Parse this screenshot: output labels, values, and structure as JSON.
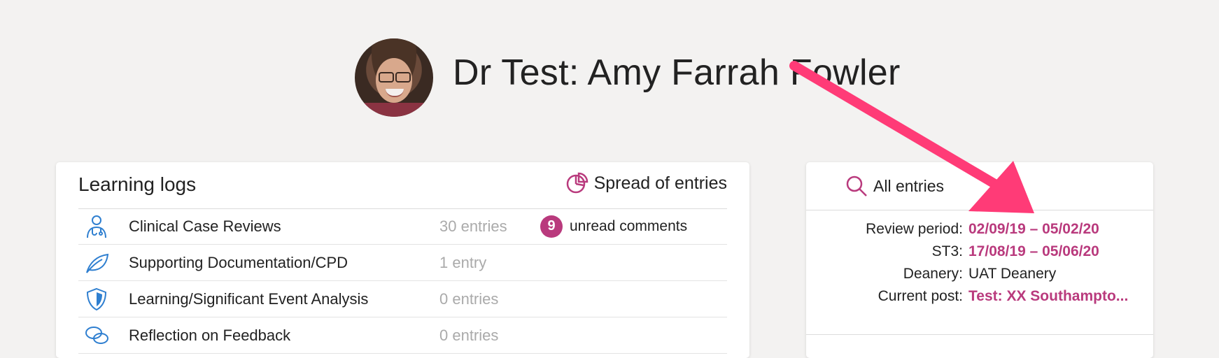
{
  "profile": {
    "name": "Dr Test: Amy Farrah Fowler"
  },
  "learning_logs": {
    "title": "Learning logs",
    "spread_label": "Spread of entries",
    "items": [
      {
        "label": "Clinical Case Reviews",
        "count": "30 entries",
        "icon": "doctor-icon",
        "unread_count": "9",
        "unread_label": "unread comments"
      },
      {
        "label": "Supporting Documentation/CPD",
        "count": "1 entry",
        "icon": "leaf-icon"
      },
      {
        "label": "Learning/Significant Event Analysis",
        "count": "0 entries",
        "icon": "shield-icon"
      },
      {
        "label": "Reflection on Feedback",
        "count": "0 entries",
        "icon": "speech-bubbles-icon"
      }
    ]
  },
  "entries_panel": {
    "all_entries_label": "All entries",
    "rows": [
      {
        "label": "Review period:",
        "value": "02/09/19 – 05/02/20"
      },
      {
        "label": "ST3:",
        "value": "17/08/19 – 05/06/20"
      },
      {
        "label": "Deanery:",
        "value": "UAT Deanery"
      },
      {
        "label": "Current post:",
        "value": "Test: XX Southampto..."
      }
    ]
  },
  "colors": {
    "accent": "#b93a7d",
    "icon_blue": "#2f7fd0",
    "annotation_arrow": "#ff3b77",
    "background": "#f3f2f1"
  }
}
